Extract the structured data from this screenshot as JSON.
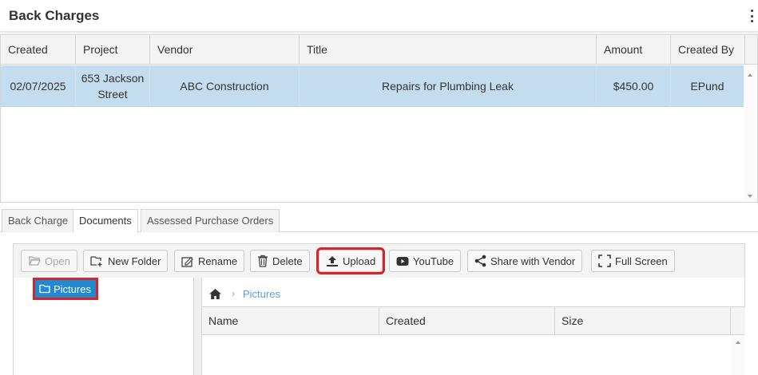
{
  "header": {
    "title": "Back Charges"
  },
  "grid": {
    "columns": [
      "Created",
      "Project",
      "Vendor",
      "Title",
      "Amount",
      "Created By"
    ],
    "rows": [
      {
        "created": "02/07/2025",
        "project": "653 Jackson Street",
        "vendor": "ABC Construction",
        "title": "Repairs for Plumbing Leak",
        "amount": "$450.00",
        "created_by": "EPund"
      }
    ]
  },
  "tabs": [
    {
      "label": "Back Charge",
      "active": false
    },
    {
      "label": "Documents",
      "active": true
    },
    {
      "label": "Assessed Purchase Orders",
      "active": false
    }
  ],
  "toolbar": {
    "open": "Open",
    "new_folder": "New Folder",
    "rename": "Rename",
    "delete": "Delete",
    "upload": "Upload",
    "youtube": "YouTube",
    "share": "Share with Vendor",
    "full_screen": "Full Screen"
  },
  "tree": {
    "folder": "Pictures"
  },
  "breadcrumb": {
    "current": "Pictures"
  },
  "files": {
    "columns": [
      "Name",
      "Created",
      "Size"
    ]
  },
  "colors": {
    "selected_row": "#c3ddef",
    "selected_node": "#1f8ad2",
    "highlight": "#d6252a",
    "link": "#5a9fd4"
  }
}
